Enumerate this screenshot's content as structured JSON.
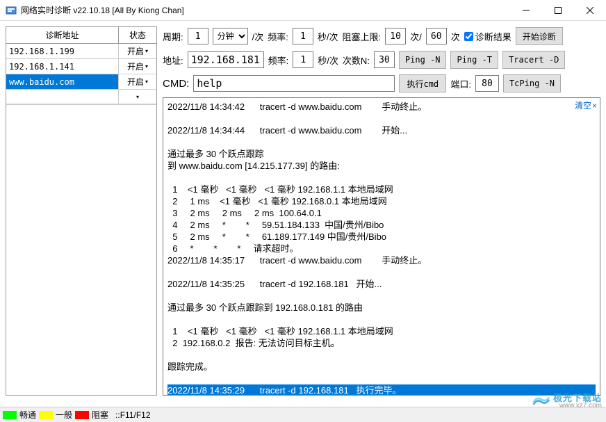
{
  "window": {
    "title": "网络实时诊断 v22.10.18 [All By Kiong Chan]"
  },
  "left": {
    "header_addr": "诊断地址",
    "header_status": "状态",
    "rows": [
      {
        "addr": "192.168.1.199",
        "status": "开启",
        "selected": false
      },
      {
        "addr": "192.168.1.141",
        "status": "开启",
        "selected": false
      },
      {
        "addr": "www.baidu.com",
        "status": "开启",
        "selected": true
      }
    ]
  },
  "row1": {
    "period_label": "周期:",
    "period_value": "1",
    "period_unit": "分钟",
    "per_times": "/次",
    "freq_label": "频率:",
    "freq_value": "1",
    "freq_unit": "秒/次",
    "block_label": "阻塞上限:",
    "block_v1": "10",
    "block_mid": "次/",
    "block_v2": "60",
    "block_suffix": "次",
    "chk_label": "诊断结果",
    "start_btn": "开始诊断"
  },
  "row2": {
    "addr_label": "地址:",
    "addr_value": "192.168.181",
    "freq_label": "频率:",
    "freq_value": "1",
    "freq_unit": "秒/次",
    "count_label": "次数N:",
    "count_value": "30",
    "ping_n": "Ping -N",
    "ping_t": "Ping -T",
    "tracert_d": "Tracert -D"
  },
  "row3": {
    "cmd_label": "CMD:",
    "cmd_value": "help",
    "exec_btn": "执行cmd",
    "port_label": "端口:",
    "port_value": "80",
    "tcping_n": "TcPing -N"
  },
  "output": {
    "clear_label": "清空",
    "lines": [
      "2022/11/8 14:34:42      tracert -d www.baidu.com        手动终止。",
      "",
      "2022/11/8 14:34:44      tracert -d www.baidu.com        开始...",
      "",
      "通过最多 30 个跃点跟踪",
      "到 www.baidu.com [14.215.177.39] 的路由:",
      "",
      "  1    <1 毫秒   <1 毫秒   <1 毫秒 192.168.1.1 本地局域网",
      "  2     1 ms    <1 毫秒   <1 毫秒 192.168.0.1 本地局域网",
      "  3     2 ms     2 ms     2 ms  100.64.0.1 ",
      "  4     2 ms     *        *     59.51.184.133  中国/贵州/Bibo",
      "  5     2 ms     *        *     61.189.177.149 中国/贵州/Bibo",
      "  6     *        *        *     请求超时。",
      "2022/11/8 14:35:17      tracert -d www.baidu.com        手动终止。",
      "",
      "2022/11/8 14:35:25      tracert -d 192.168.181   开始...",
      "",
      "通过最多 30 个跃点跟踪到 192.168.0.181 的路由",
      "",
      "  1    <1 毫秒   <1 毫秒   <1 毫秒 192.168.1.1 本地局域网",
      "  2  192.168.0.2  报告: 无法访问目标主机。",
      "",
      "跟踪完成。",
      ""
    ],
    "highlighted_line": "2022/11/8 14:35:29      tracert -d 192.168.181   执行完毕。"
  },
  "statusbar": {
    "ok": "畅通",
    "normal": "一般",
    "blocked": "阻塞",
    "keys": "::F11/F12"
  },
  "watermark": {
    "text": "极光下载站",
    "url": "www.xz7.com"
  }
}
